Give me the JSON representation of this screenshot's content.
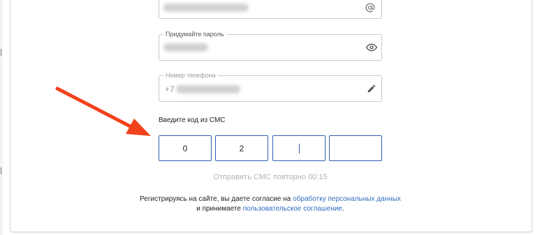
{
  "form": {
    "email_field": {
      "value_hidden": true,
      "icon": "at-sign-icon"
    },
    "password_field": {
      "label": "Придумайте пароль",
      "value_hidden": true,
      "icon": "eye-icon"
    },
    "phone_field": {
      "label": "Номер телефона",
      "prefix": "+7",
      "value_hidden": true,
      "icon": "pencil-icon"
    }
  },
  "sms": {
    "title": "Введите код из СМС",
    "digits": [
      "0",
      "2",
      "",
      ""
    ],
    "active_index": 2,
    "resend_text": "Отправить СМС повторно 00:15"
  },
  "consent": {
    "part1": "Регистрируясь на сайте, вы даете согласие на",
    "link1": "обработку персональных данных",
    "part2": "и принимаете",
    "link2": "пользовательское соглашение",
    "end": "."
  },
  "annotation": {
    "type": "arrow",
    "color": "#f2421b",
    "points_to": "sms-code-input"
  },
  "colors": {
    "accent": "#2f5fb0",
    "link": "#2f6bc0",
    "arrow": "#f2421b"
  }
}
